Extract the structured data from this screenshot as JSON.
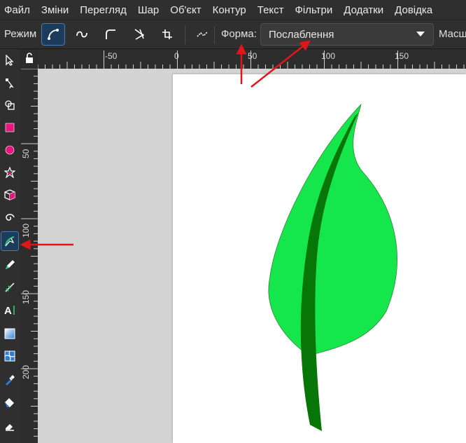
{
  "menu": [
    "Файл",
    "Зміни",
    "Перегляд",
    "Шар",
    "Об'єкт",
    "Контур",
    "Текст",
    "Фільтри",
    "Додатки",
    "Довідка"
  ],
  "toolbar": {
    "mode_label": "Режим",
    "shape_label": "Форма:",
    "shape_value": "Послаблення",
    "scale_label": "Масшт"
  },
  "rulers": {
    "horizontal": [
      "-50",
      "0",
      "50",
      "100",
      "150"
    ],
    "vertical": [
      "50",
      "100",
      "150",
      "200"
    ]
  },
  "tools": [
    "select-tool",
    "node-tool",
    "shape-builder-tool",
    "rectangle-tool",
    "ellipse-tool",
    "star-tool",
    "3d-box-tool",
    "spiral-tool",
    "pen-tool",
    "pencil-tool",
    "calligraphy-tool",
    "text-tool",
    "gradient-tool",
    "mesh-tool",
    "dropper-tool",
    "paint-bucket-tool",
    "eraser-tool"
  ],
  "colors": {
    "leaf_fill": "#15e64b",
    "stem_fill": "#077507",
    "active_tool": "#1d3b5a",
    "annotation_arrow": "#e0161a"
  }
}
